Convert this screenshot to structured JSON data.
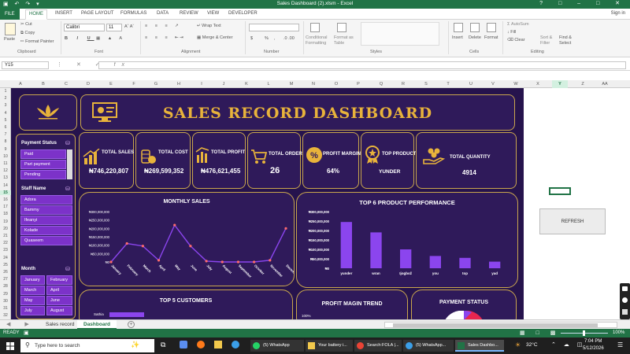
{
  "window": {
    "title": "Sales Dashboard (2).xlsm - Excel",
    "quick_access": "▣ ↶ ↷ ▾"
  },
  "ribbon_tabs": {
    "file": "FILE",
    "home": "HOME",
    "insert": "INSERT",
    "page_layout": "PAGE LAYOUT",
    "formulas": "FORMULAS",
    "data": "DATA",
    "review": "REVIEW",
    "view": "VIEW",
    "developer": "DEVELOPER",
    "sign_in": "Sign in"
  },
  "ribbon": {
    "clipboard": {
      "paste": "Paste",
      "cut": "Cut",
      "copy": "Copy",
      "format_painter": "Format Painter",
      "group": "Clipboard"
    },
    "font": {
      "name": "Calibri",
      "size": "11",
      "group": "Font"
    },
    "alignment": {
      "wrap": "Wrap Text",
      "merge": "Merge & Center",
      "group": "Alignment"
    },
    "number": {
      "currency": "$",
      "percent": "%",
      "comma": ",",
      "group": "Number"
    },
    "styles": {
      "conditional": "Conditional Formatting",
      "format_as_table": "Format as Table",
      "cell_styles": "Cell Styles",
      "group": "Styles"
    },
    "cells": {
      "insert": "Insert",
      "delete": "Delete",
      "format": "Format",
      "group": "Cells"
    },
    "editing": {
      "autosum": "AutoSum",
      "fill": "Fill",
      "clear": "Clear",
      "sort": "Sort & Filter",
      "find": "Find & Select",
      "group": "Editing"
    }
  },
  "formula_bar": {
    "name_box": "Y15",
    "value": ""
  },
  "columns": [
    "A",
    "B",
    "C",
    "D",
    "E",
    "F",
    "G",
    "H",
    "I",
    "J",
    "K",
    "L",
    "M",
    "N",
    "O",
    "P",
    "Q",
    "R",
    "S",
    "T",
    "U",
    "V",
    "W",
    "X",
    "Y",
    "Z",
    "AA"
  ],
  "selected_column": "Y",
  "rows": [
    "1",
    "2",
    "3",
    "4",
    "5",
    "6",
    "7",
    "8",
    "9",
    "10",
    "11",
    "12",
    "13",
    "14",
    "15",
    "16",
    "17",
    "18",
    "19",
    "20",
    "21",
    "22",
    "23",
    "24",
    "25",
    "26",
    "27",
    "28",
    "29",
    "30",
    "31",
    "32"
  ],
  "selected_row": "15",
  "dashboard": {
    "title": "SALES RECORD DASHBOARD",
    "kpis": [
      {
        "label": "TOTAL SALES",
        "value": "₦746,220,807"
      },
      {
        "label": "TOTAL COST",
        "value": "₦269,599,352"
      },
      {
        "label": "TOTAL PROFIT",
        "value": "₦476,621,455"
      },
      {
        "label": "TOTAL ORDER",
        "value": "26"
      },
      {
        "label": "PROFIT MARGIN",
        "value": "64%"
      },
      {
        "label": "TOP PRODUCT",
        "value": "YUNDER"
      },
      {
        "label": "TOTAL QUANTITY",
        "value": "4914"
      }
    ],
    "payment_status": {
      "title": "Payment Status",
      "items": [
        "Paid",
        "Part payment",
        "Pending"
      ]
    },
    "staff": {
      "title": "Staff Name",
      "items": [
        "Adora",
        "Bammy",
        "Ifeanyi",
        "Kolade",
        "Quaseem"
      ]
    },
    "month": {
      "title": "Month",
      "items": [
        "January",
        "February",
        "March",
        "April",
        "May",
        "June",
        "July",
        "August"
      ]
    },
    "panels": {
      "monthly_sales": "MONTHLY SALES",
      "top_products": "TOP 6  PRODUCT PERFORMANCE",
      "top_customers": "TOP 5 CUSTOMERS",
      "profit_margin": "PROFIT MAGIN TREND",
      "payment_status": "PAYMENT STATUS"
    },
    "top_customer_first": "Sathia",
    "profit_margin_tick": "100%"
  },
  "chart_data": [
    {
      "type": "line",
      "title": "MONTHLY SALES",
      "categories": [
        "January",
        "February",
        "March",
        "April",
        "May",
        "June",
        "July",
        "August",
        "September",
        "October",
        "November",
        "December"
      ],
      "values": [
        0,
        110000000,
        95000000,
        10000000,
        220000000,
        95000000,
        5000000,
        0,
        0,
        0,
        10000000,
        200000000
      ],
      "ylim": [
        0,
        300000000
      ],
      "yticks": [
        "₦300,000,000",
        "₦250,000,000",
        "₦200,000,000",
        "₦150,000,000",
        "₦100,000,000",
        "₦50,000,000",
        "₦0"
      ],
      "color": "#8b45ee"
    },
    {
      "type": "bar",
      "title": "TOP 6  PRODUCT PERFORMANCE",
      "categories": [
        "yunder",
        "wran",
        "Ijogbož",
        "you",
        "top",
        "yad"
      ],
      "values": [
        245000000,
        190000000,
        100000000,
        65000000,
        55000000,
        35000000
      ],
      "ylim": [
        0,
        300000000
      ],
      "yticks": [
        "₦300,000,000",
        "₦250,000,000",
        "₦200,000,000",
        "₦150,000,000",
        "₦100,000,000",
        "₦50,000,000",
        "₦0"
      ],
      "color": "#8b45ee"
    }
  ],
  "refresh_button": "REFRESH",
  "sheets": {
    "tab1": "Sales record",
    "tab2": "Dashboard",
    "add": "+"
  },
  "status": {
    "mode": "READY",
    "zoom": "100%"
  },
  "taskbar": {
    "search": "Type here to search",
    "apps": [
      "(5) WhatsApp",
      "Your battery i...",
      "Search:FOLA |...",
      "(5) WhatsApp...",
      "Sales Dashbo..."
    ],
    "weather": "32°C",
    "time": "7:04 PM",
    "date": "5/12/2026"
  },
  "colors": {
    "excel_green": "#217346",
    "dash_bg": "#26134d",
    "panel_bg": "#2f1a5a",
    "gold": "#e8b33b",
    "accent_purple": "#8b45ee"
  }
}
